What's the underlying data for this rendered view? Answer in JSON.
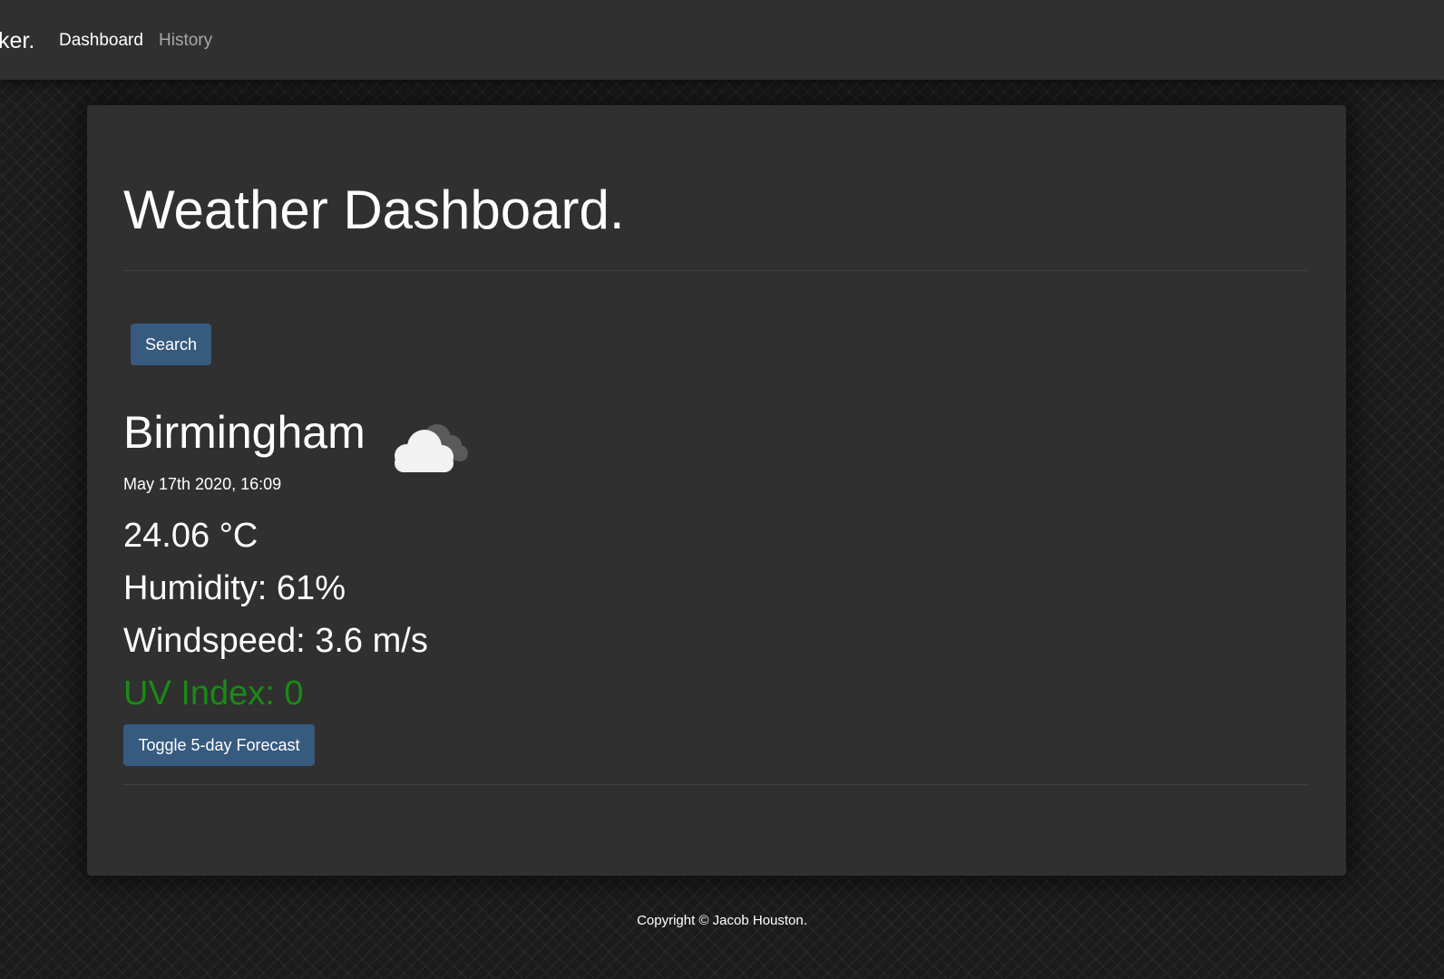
{
  "navbar": {
    "brand_visible": "ker.",
    "links": [
      {
        "label": "Dashboard",
        "active": true
      },
      {
        "label": "History",
        "active": false
      }
    ]
  },
  "dashboard": {
    "title": "Weather Dashboard.",
    "search_button": "Search",
    "weather": {
      "city": "Birmingham",
      "icon": "cloud-icon",
      "datetime": "May 17th 2020, 16:09",
      "temperature": "24.06 °C",
      "humidity": "Humidity: 61%",
      "windspeed": "Windspeed: 3.6 m/s",
      "uv_index": "UV Index: 0",
      "uv_color": "#1a8a16"
    },
    "toggle_button": "Toggle 5-day Forecast"
  },
  "footer": {
    "copyright": "Copyright © Jacob Houston."
  },
  "colors": {
    "accent": "#375a7f",
    "panel": "#303030",
    "background": "#1b1b1b"
  }
}
